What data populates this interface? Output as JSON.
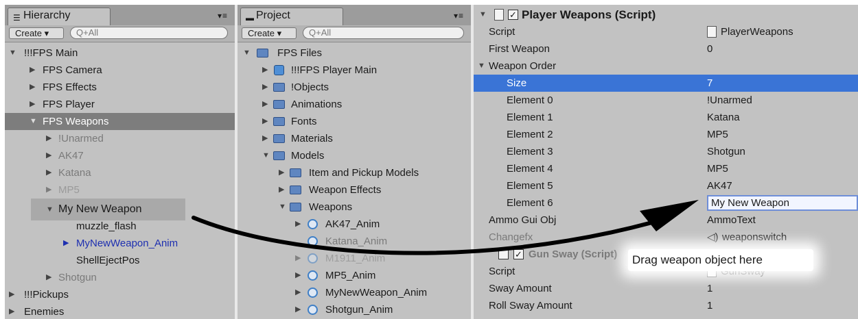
{
  "hierarchy": {
    "tab_label": "Hierarchy",
    "create_label": "Create",
    "search_placeholder": "Q+All",
    "items": [
      {
        "label": "!!!FPS Main"
      },
      {
        "label": "FPS Camera"
      },
      {
        "label": "FPS Effects"
      },
      {
        "label": "FPS Player"
      },
      {
        "label": "FPS Weapons"
      },
      {
        "label": "!Unarmed"
      },
      {
        "label": "AK47"
      },
      {
        "label": "Katana"
      },
      {
        "label": "MP5"
      },
      {
        "label": "My New Weapon"
      },
      {
        "label": "muzzle_flash"
      },
      {
        "label": "MyNewWeapon_Anim"
      },
      {
        "label": "ShellEjectPos"
      },
      {
        "label": "Shotgun"
      },
      {
        "label": "!!!Pickups"
      },
      {
        "label": "Enemies"
      }
    ]
  },
  "project": {
    "tab_label": "Project",
    "create_label": "Create",
    "search_placeholder": "Q+All",
    "items": [
      {
        "label": "FPS Files"
      },
      {
        "label": "!!!FPS Player Main"
      },
      {
        "label": "!Objects"
      },
      {
        "label": "Animations"
      },
      {
        "label": "Fonts"
      },
      {
        "label": "Materials"
      },
      {
        "label": "Models"
      },
      {
        "label": "Item and Pickup Models"
      },
      {
        "label": "Weapon Effects"
      },
      {
        "label": "Weapons"
      },
      {
        "label": "AK47_Anim"
      },
      {
        "label": "Katana_Anim"
      },
      {
        "label": "M1911_Anim"
      },
      {
        "label": "MP5_Anim"
      },
      {
        "label": "MyNewWeapon_Anim"
      },
      {
        "label": "Shotgun_Anim"
      }
    ]
  },
  "inspector": {
    "component_title": "Player Weapons (Script)",
    "rows": [
      {
        "name": "Script",
        "value": "PlayerWeapons"
      },
      {
        "name": "First Weapon",
        "value": "0"
      },
      {
        "name": "Weapon Order",
        "value": ""
      },
      {
        "name": "Size",
        "value": "7"
      },
      {
        "name": "Element 0",
        "value": "!Unarmed"
      },
      {
        "name": "Element 1",
        "value": "Katana"
      },
      {
        "name": "Element 2",
        "value": "MP5"
      },
      {
        "name": "Element 3",
        "value": "Shotgun"
      },
      {
        "name": "Element 4",
        "value": "MP5"
      },
      {
        "name": "Element 5",
        "value": "AK47"
      },
      {
        "name": "Element 6",
        "value": "My New Weapon"
      },
      {
        "name": "Ammo Gui Obj",
        "value": "AmmoText"
      },
      {
        "name": "Changefx",
        "value": "weaponswitch"
      },
      {
        "name": "Gun Sway (Script)",
        "value": ""
      },
      {
        "name": "Script",
        "value": "GunSway"
      },
      {
        "name": "Sway Amount",
        "value": "1"
      },
      {
        "name": "Roll Sway Amount",
        "value": "1"
      }
    ]
  },
  "callout": {
    "text": "Drag weapon object here"
  },
  "colors": {
    "selection_blue": "#3a74d6",
    "selection_gray": "#7d7d7d",
    "panel_bg": "#c2c2c2"
  }
}
